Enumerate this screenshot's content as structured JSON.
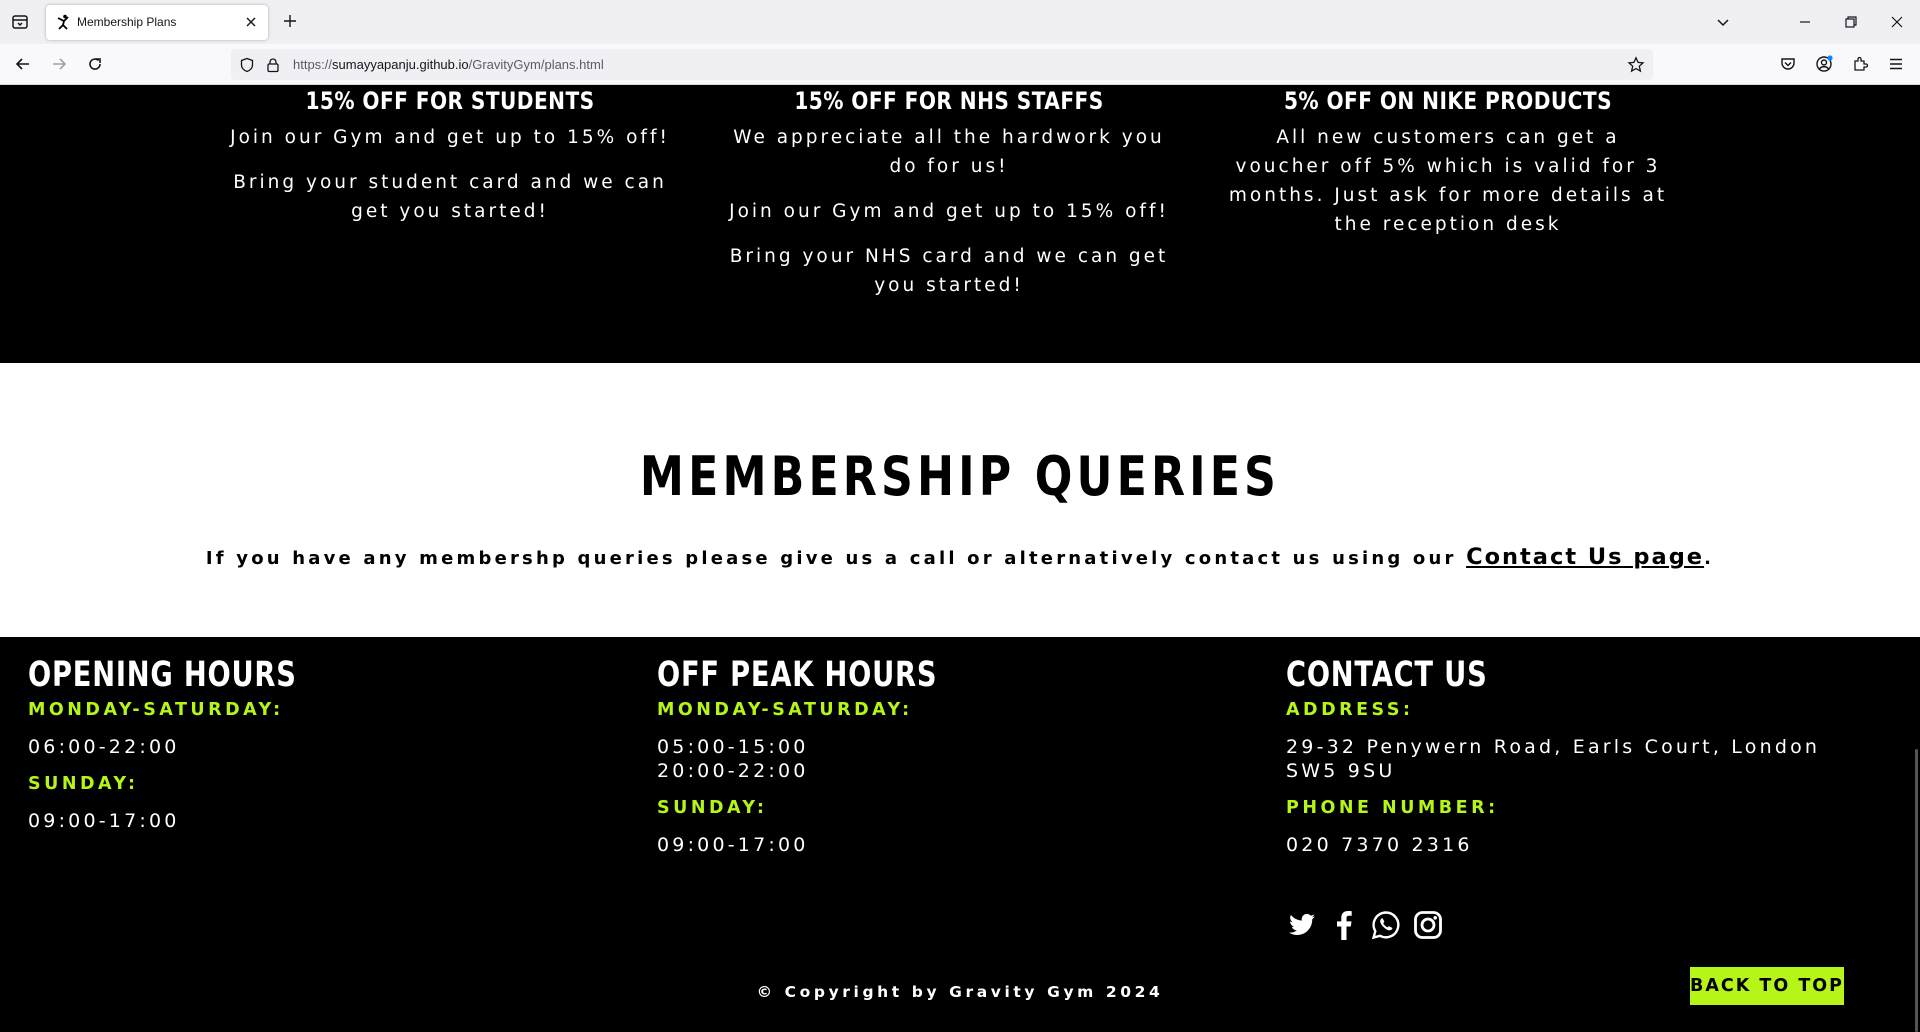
{
  "browser": {
    "tab_title": "Membership Plans",
    "url_prefix": "https://",
    "url_domain": "sumayyapanju.github.io",
    "url_path": "/GravityGym/plans.html"
  },
  "offers": [
    {
      "title": "15% OFF FOR STUDENTS",
      "paragraphs": [
        "Join our Gym and get up to 15% off!",
        "Bring your student card and we can get you started!"
      ]
    },
    {
      "title": "15% OFF FOR NHS STAFFS",
      "paragraphs": [
        "We appreciate all the hardwork you do for us!",
        "Join our Gym and get up to 15% off!",
        "Bring your NHS card and we can get you started!"
      ]
    },
    {
      "title": "5% OFF ON NIKE PRODUCTS",
      "paragraphs": [
        "All new customers can get a voucher off 5% which is valid for 3 months. Just ask for more details at the reception desk"
      ]
    }
  ],
  "queries": {
    "heading": "MEMBERSHIP QUERIES",
    "text": "If you have any membershp queries please give us a call or alternatively contact us using our ",
    "link_text": "Contact Us page",
    "suffix": "."
  },
  "footer": {
    "opening": {
      "heading": "OPENING HOURS",
      "weekday_label": "MONDAY-SATURDAY:",
      "weekday_hours": "06:00-22:00",
      "sunday_label": "SUNDAY:",
      "sunday_hours": "09:00-17:00"
    },
    "offpeak": {
      "heading": "OFF PEAK HOURS",
      "weekday_label": "MONDAY-SATURDAY:",
      "weekday_hours_1": "05:00-15:00",
      "weekday_hours_2": "20:00-22:00",
      "sunday_label": "SUNDAY:",
      "sunday_hours": "09:00-17:00"
    },
    "contact": {
      "heading": "CONTACT US",
      "address_label": "ADDRESS:",
      "address": "29-32 Penywern Road, Earls Court, London SW5 9SU",
      "phone_label": "PHONE NUMBER:",
      "phone": "020 7370 2316"
    },
    "social_icons": [
      "twitter-icon",
      "facebook-icon",
      "whatsapp-icon",
      "instagram-icon"
    ],
    "copyright": "© Copyright by Gravity Gym 2024",
    "back_to_top": "BACK TO TOP"
  },
  "colors": {
    "accent": "#b5f517",
    "background": "#000000",
    "queries_background": "#ffffff"
  }
}
